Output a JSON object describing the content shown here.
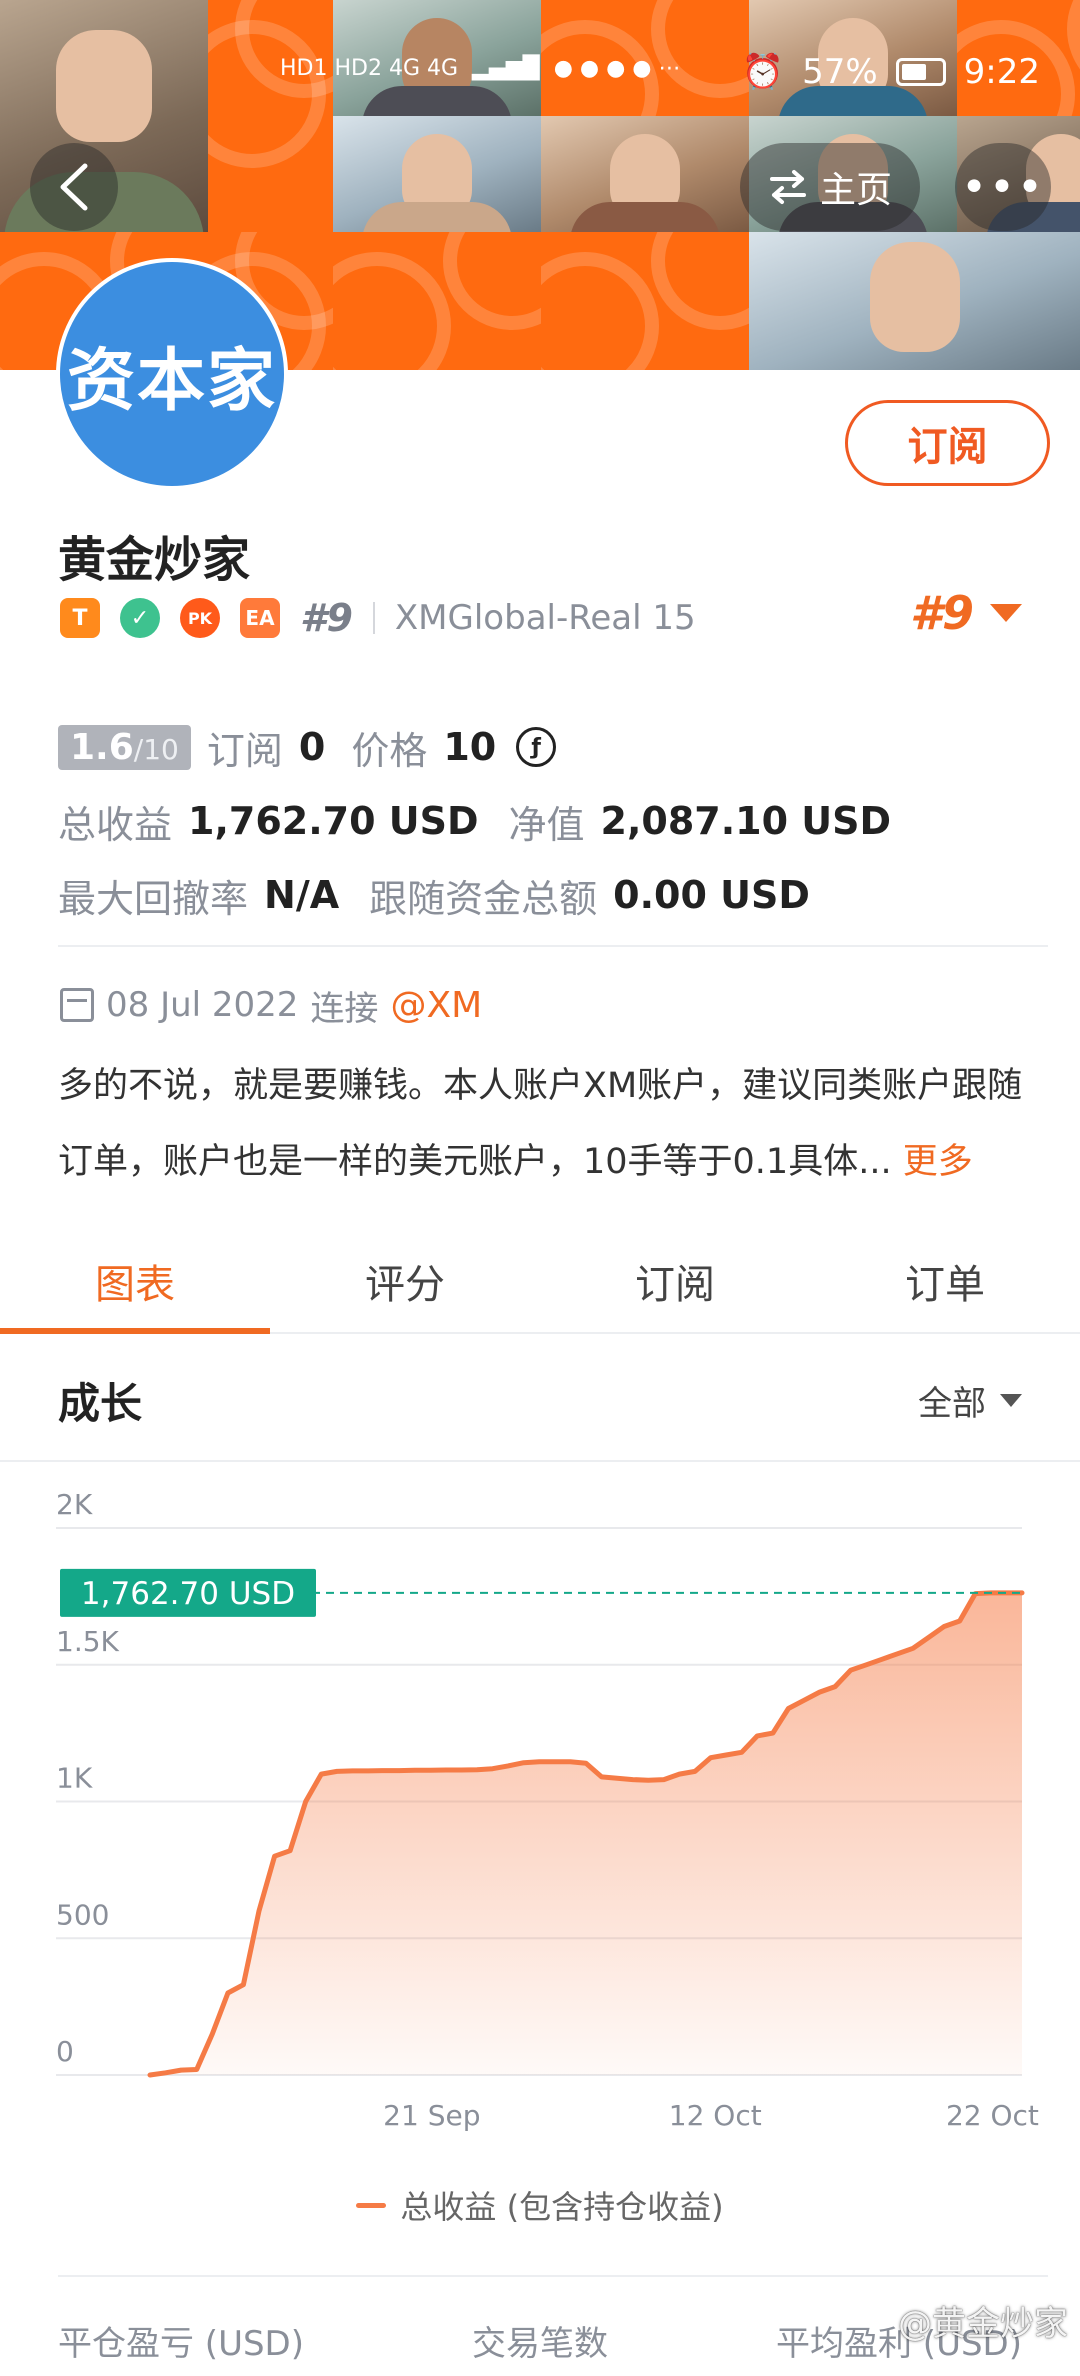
{
  "status_bar": {
    "signal_text": "HD1 HD2 4G 4G",
    "battery": "57%",
    "time": "9:22"
  },
  "header": {
    "home_label": "主页",
    "more_label": "•••"
  },
  "profile": {
    "avatar_text": "资本家",
    "subscribe_label": "订阅",
    "name": "黄金炒家",
    "badges": [
      "T",
      "✓",
      "PK",
      "EA"
    ],
    "rank_inline": "#9",
    "account": "XMGlobal-Real 15",
    "rank_right": "#9"
  },
  "stats": {
    "score": "1.6",
    "score_max": "/10",
    "subscribe_label": "订阅",
    "subscribe_count": "0",
    "price_label": "价格",
    "price_value": "10",
    "coin_symbol": "ƒ",
    "total_profit_label": "总收益",
    "total_profit_value": "1,762.70 USD",
    "equity_label": "净值",
    "equity_value": "2,087.10 USD",
    "max_drawdown_label": "最大回撤率",
    "max_drawdown_value": "N/A",
    "follow_funds_label": "跟随资金总额",
    "follow_funds_value": "0.00 USD"
  },
  "connect": {
    "date": "08 Jul 2022",
    "label": "连接",
    "broker": "@XM"
  },
  "description": {
    "text": "多的不说，就是要赚钱。本人账户XM账户，建议同类账户跟随订单，账户也是一样的美元账户，10手等于0.1具体...",
    "more": "更多"
  },
  "tabs": [
    {
      "label": "图表",
      "active": true
    },
    {
      "label": "评分",
      "active": false
    },
    {
      "label": "订阅",
      "active": false
    },
    {
      "label": "订单",
      "active": false
    }
  ],
  "growth": {
    "title": "成长",
    "range": "全部"
  },
  "chart_data": {
    "type": "area",
    "ylim": [
      0,
      2000
    ],
    "yticks": [
      "0",
      "500",
      "1K",
      "1.5K",
      "2K"
    ],
    "ytick_values": [
      0,
      500,
      1000,
      1500,
      2000
    ],
    "xticks": [
      "21 Sep",
      "12 Oct",
      "22 Oct"
    ],
    "xtick_index": [
      18.1,
      36.3,
      54.1
    ],
    "current_label": "1,762.70 USD",
    "current_value": 1762.7,
    "series": [
      {
        "name": "总收益 (包含持仓收益)",
        "color": "#f57b46",
        "values": [
          0,
          8,
          18,
          20,
          150,
          300,
          330,
          600,
          800,
          820,
          1000,
          1100,
          1110,
          1112,
          1112,
          1113,
          1113,
          1114,
          1114,
          1115,
          1115,
          1116,
          1120,
          1130,
          1142,
          1145,
          1145,
          1145,
          1140,
          1090,
          1085,
          1080,
          1078,
          1080,
          1100,
          1110,
          1160,
          1170,
          1180,
          1240,
          1250,
          1340,
          1370,
          1400,
          1420,
          1480,
          1500,
          1520,
          1540,
          1560,
          1600,
          1640,
          1660,
          1760,
          1762.7,
          1762.7,
          1762.7
        ]
      }
    ]
  },
  "legend": {
    "label": "总收益 (包含持仓收益)"
  },
  "bottom_stats": [
    "平仓盈亏 (USD)",
    "交易笔数",
    "平均盈利 (USD)"
  ],
  "watermark": "@黄金炒家",
  "colors": {
    "accent": "#f06a22",
    "chart_line": "#f57b46",
    "current_tag": "#14a889",
    "avatar": "#3c8ee0"
  }
}
